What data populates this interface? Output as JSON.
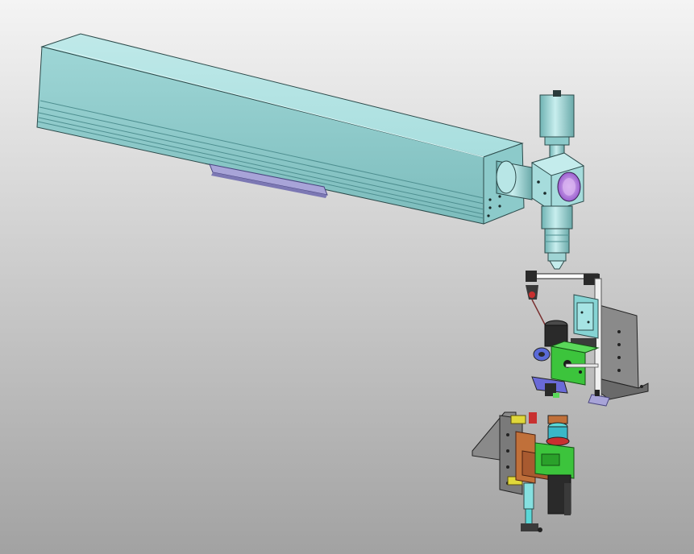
{
  "scene": {
    "type": "cad-3d-viewport",
    "background": {
      "top_color": "#f4f4f4",
      "bottom_color": "#a2a2a2"
    },
    "palette": {
      "cyan_body": "#a6dcdc",
      "cyan_dark": "#6fb3b3",
      "cyan_shadow": "#4e8f90",
      "lens_purple": "#b98be0",
      "plate_purple": "#a8a4d8",
      "bracket_gray": "#7d7d7d",
      "dark_gray": "#3d3d3d",
      "green_block": "#3cc43c",
      "blue_part": "#5a6ad8",
      "yellow_part": "#e0d83a",
      "orange_part": "#c0703a",
      "red_part": "#c83030",
      "light_teal": "#86e0e0"
    },
    "components": [
      "linear-actuator-housing",
      "actuator-slider-plate",
      "laser-head-coupler",
      "laser-head-cube",
      "laser-head-camera",
      "focusing-nozzle",
      "upper-fixture-assembly",
      "lower-fixture-assembly"
    ]
  }
}
